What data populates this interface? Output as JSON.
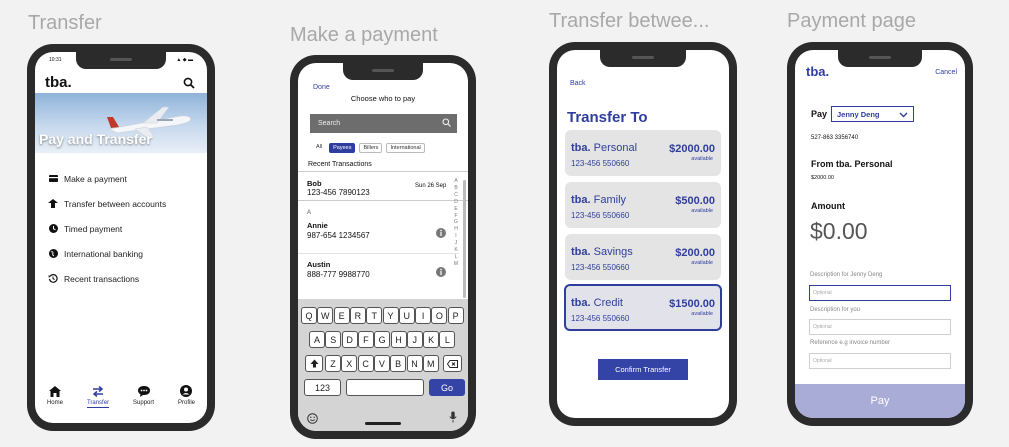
{
  "screens": {
    "transfer": {
      "title": "Transfer",
      "status_time": "10:31",
      "status_icons": "▲ ◆ ▬",
      "logo": "tba.",
      "hero_title": "Pay and Transfer",
      "menu": [
        {
          "label": "Make a payment",
          "icon": "card-icon"
        },
        {
          "label": "Transfer between accounts",
          "icon": "transfer-icon"
        },
        {
          "label": "Timed payment",
          "icon": "clock-icon"
        },
        {
          "label": "International banking",
          "icon": "globe-icon"
        },
        {
          "label": "Recent transactions",
          "icon": "history-icon"
        }
      ],
      "tabs": [
        {
          "label": "Home",
          "icon": "home-icon"
        },
        {
          "label": "Transfer",
          "icon": "transfer-arrows-icon"
        },
        {
          "label": "Support",
          "icon": "chat-icon"
        },
        {
          "label": "Profile",
          "icon": "profile-icon"
        }
      ]
    },
    "payment": {
      "title": "Make a payment",
      "done": "Done",
      "heading": "Choose who to pay",
      "search_placeholder": "Search",
      "filters": [
        "All",
        "Payees",
        "Billers",
        "International"
      ],
      "recent_label": "Recent Transactions",
      "recent": {
        "name": "Bob",
        "number": "123-456 7890123",
        "date": "Sun 26 Sep"
      },
      "section_letter": "A",
      "contacts": [
        {
          "name": "Annie",
          "number": "987-654 1234567"
        },
        {
          "name": "Austin",
          "number": "888-777 9988770"
        }
      ],
      "alphabet": [
        "A",
        "B",
        "C",
        "D",
        "E",
        "F",
        "G",
        "H",
        "I",
        "J",
        "K",
        "L",
        "M"
      ],
      "keyboard": {
        "row1": [
          "Q",
          "W",
          "E",
          "R",
          "T",
          "Y",
          "U",
          "I",
          "O",
          "P"
        ],
        "row2": [
          "A",
          "S",
          "D",
          "F",
          "G",
          "H",
          "J",
          "K",
          "L"
        ],
        "row3": [
          "Z",
          "X",
          "C",
          "V",
          "B",
          "N",
          "M"
        ],
        "numbers": "123",
        "go": "Go"
      }
    },
    "transfer_between": {
      "title": "Transfer betwee...",
      "back": "Back",
      "heading": "Transfer To",
      "accounts": [
        {
          "brand": "tba.",
          "name": "Personal",
          "number": "123-456 550660",
          "amount": "$2000.00",
          "available": "available"
        },
        {
          "brand": "tba.",
          "name": "Family",
          "number": "123-456 550660",
          "amount": "$500.00",
          "available": "available"
        },
        {
          "brand": "tba.",
          "name": "Savings",
          "number": "123-456 550660",
          "amount": "$200.00",
          "available": "available"
        },
        {
          "brand": "tba.",
          "name": "Credit",
          "number": "123-456 550660",
          "amount": "$1500.00",
          "available": "available"
        }
      ],
      "confirm": "Confirm Transfer"
    },
    "payment_page": {
      "title": "Payment page",
      "logo": "tba.",
      "cancel": "Cancel",
      "pay_label": "Pay",
      "payee": "Jenny Deng",
      "payee_account": "527-863  3356740",
      "from_label": "From tba. Personal",
      "from_balance": "$2000.00",
      "amount_label": "Amount",
      "amount_value": "$0.00",
      "desc_payee_label": "Description for Jenny Deng",
      "desc_you_label": "Description for you",
      "reference_label": "Reference e.g invoice number",
      "optional": "Optional",
      "pay_button": "Pay"
    }
  },
  "colors": {
    "accent": "#2f3e9e",
    "pay_button": "#a9acd6",
    "card": "#e4e4e4"
  }
}
